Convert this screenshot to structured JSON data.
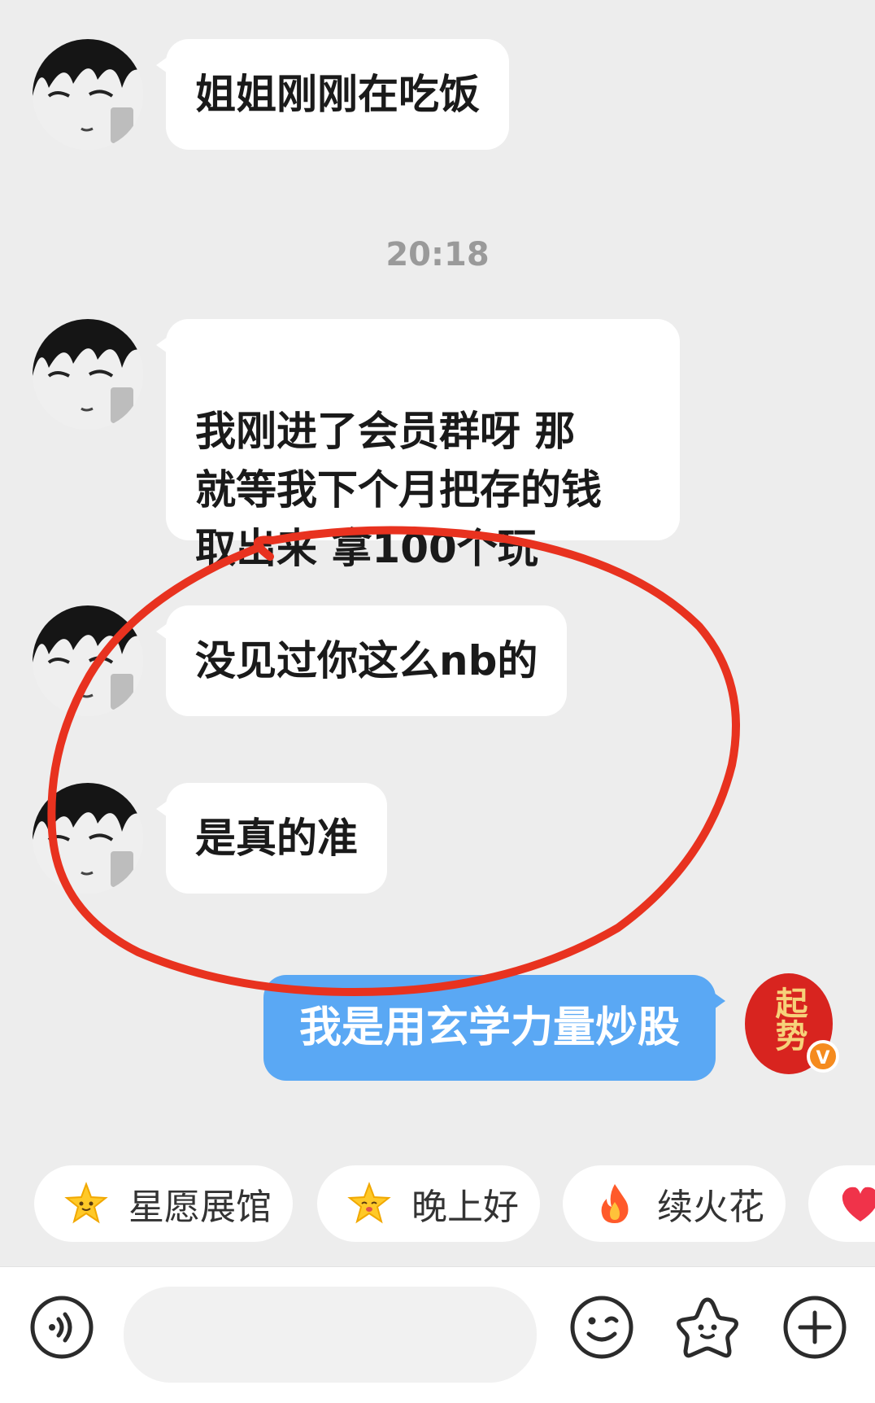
{
  "messages": [
    {
      "text": "姐姐刚刚在吃饭"
    },
    {
      "text": "我刚进了会员群呀  那\n就等我下个月把存的钱\n取出来 拿100个玩"
    },
    {
      "text": "没见过你这么nb的"
    },
    {
      "text": "是真的准"
    }
  ],
  "timestamp": "20:18",
  "outgoing": {
    "text": "我是用玄学力量炒股"
  },
  "outgoing_avatar": {
    "text": "起势",
    "badge": "V"
  },
  "quick_replies": [
    {
      "label": "星愿展馆",
      "icon": "star-face-icon"
    },
    {
      "label": "晚上好",
      "icon": "star-face-icon"
    },
    {
      "label": "续火花",
      "icon": "fire-icon"
    },
    {
      "label": "",
      "icon": "heart-icon"
    }
  ],
  "input": {
    "placeholder": ""
  },
  "colors": {
    "outgoing_bubble": "#5aa8f4",
    "annotation": "#e8321f"
  }
}
